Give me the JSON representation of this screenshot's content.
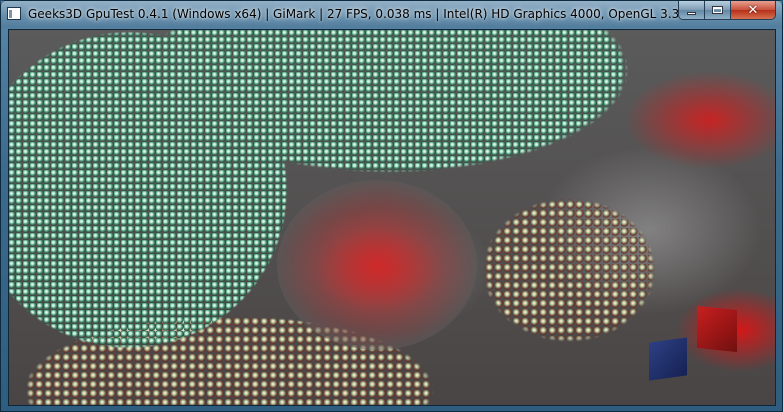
{
  "window": {
    "title": "Geeks3D GpuTest 0.4.1 (Windows x64) | GiMark | 27 FPS, 0.038 ms | Intel(R) HD Graphics 4000, OpenGL 3.3",
    "app_icon": "window-app-icon",
    "controls": {
      "minimize_icon": "minimize-icon",
      "maximize_icon": "maximize-icon",
      "close_label": "✕"
    }
  },
  "colors": {
    "title_bar": "#3d6b8c",
    "close_button": "#c7503b",
    "particles": "#6fb99a",
    "fog_red": "#c82828"
  }
}
